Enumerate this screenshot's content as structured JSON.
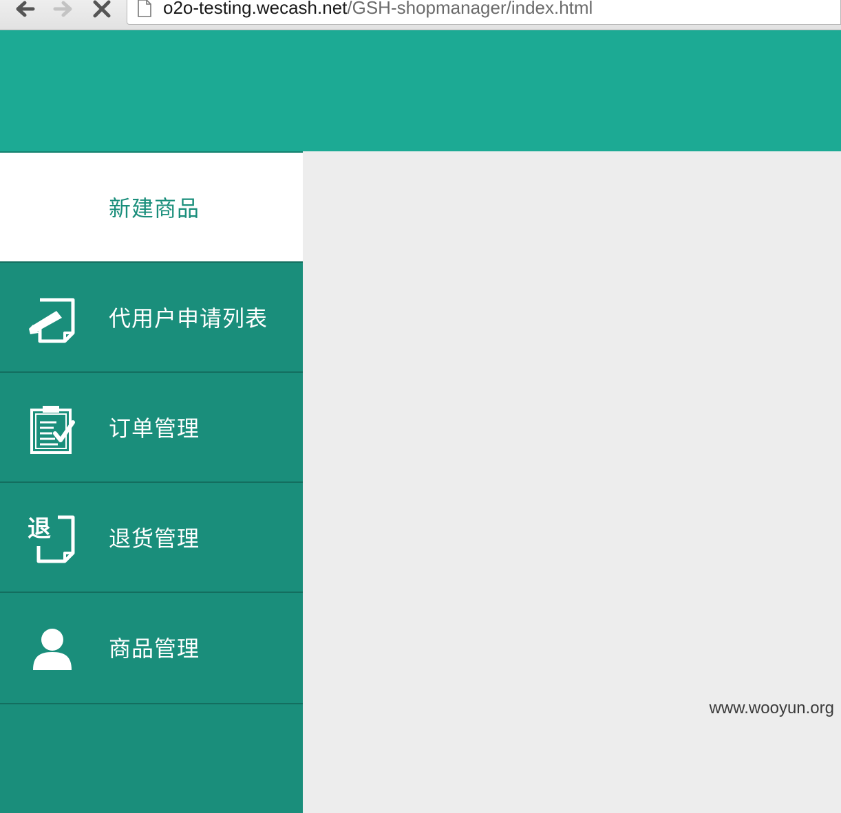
{
  "browser": {
    "url_host": "o2o-testing.wecash.net",
    "url_path": "/GSH-shopmanager/index.html",
    "back_icon": "arrow-left-icon",
    "forward_icon": "arrow-right-icon",
    "stop_icon": "close-icon"
  },
  "header": {
    "background_color": "#1caa94"
  },
  "sidebar": {
    "background_color": "#1a8e7b",
    "items": [
      {
        "label": "新建商品",
        "icon": "none",
        "active": true
      },
      {
        "label": "代用户申请列表",
        "icon": "edit-document-icon",
        "active": false
      },
      {
        "label": "订单管理",
        "icon": "clipboard-check-icon",
        "active": false
      },
      {
        "label": "退货管理",
        "icon": "return-document-icon",
        "active": false
      },
      {
        "label": "商品管理",
        "icon": "user-icon",
        "active": false
      }
    ]
  },
  "watermark": "www.wooyun.org"
}
